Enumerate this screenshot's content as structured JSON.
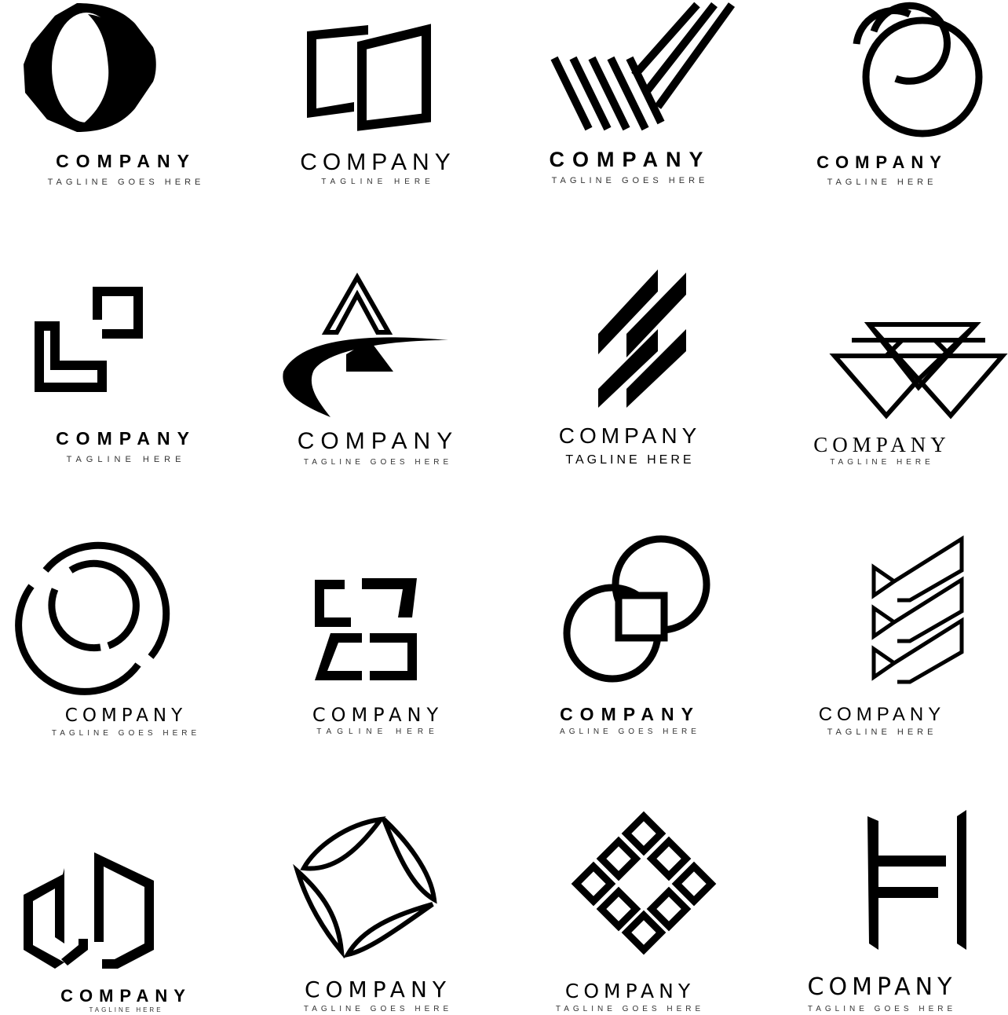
{
  "logos": [
    {
      "name": "COMPANY",
      "tagline": "TAGLINE GOES HERE",
      "icon": "rounded-o-icon"
    },
    {
      "name": "COMPANY",
      "tagline": "TAGLINE HERE",
      "icon": "open-book-icon"
    },
    {
      "name": "COMPANY",
      "tagline": "TAGLINE GOES HERE",
      "icon": "striped-check-icon"
    },
    {
      "name": "COMPANY",
      "tagline": "TAGLINE HERE",
      "icon": "interlocking-circles-icon"
    },
    {
      "name": "COMPANY",
      "tagline": "TAGLINE HERE",
      "icon": "stepped-squares-icon"
    },
    {
      "name": "COMPANY",
      "tagline": "TAGLINE GOES HERE",
      "icon": "swoosh-a-icon"
    },
    {
      "name": "COMPANY",
      "tagline": "TAGLINE HERE",
      "icon": "slanted-bars-icon"
    },
    {
      "name": "COMPANY",
      "tagline": "TAGLINE HERE",
      "icon": "triangle-grid-icon"
    },
    {
      "name": "COMPANY",
      "tagline": "TAGLINE GOES HERE",
      "icon": "broken-ring-icon"
    },
    {
      "name": "COMPANY",
      "tagline": "TAGLINE HERE",
      "icon": "mirrored-frames-icon"
    },
    {
      "name": "COMPANY",
      "tagline": "AGLINE GOES HERE",
      "icon": "linked-circles-icon"
    },
    {
      "name": "COMPANY",
      "tagline": "TAGLINE HERE",
      "icon": "chevron-stack-icon"
    },
    {
      "name": "COMPANY",
      "tagline": "TAGLINE HERE",
      "icon": "hexagon-u-icon"
    },
    {
      "name": "COMPANY",
      "tagline": "TAGLINE GOES HERE",
      "icon": "leaf-diamond-icon"
    },
    {
      "name": "COMPANY",
      "tagline": "TAGLINE GOES HERE",
      "icon": "diamond-squares-icon"
    },
    {
      "name": "COMPANY",
      "tagline": "TAGLINE GOES HERE",
      "icon": "h-letter-icon"
    }
  ]
}
